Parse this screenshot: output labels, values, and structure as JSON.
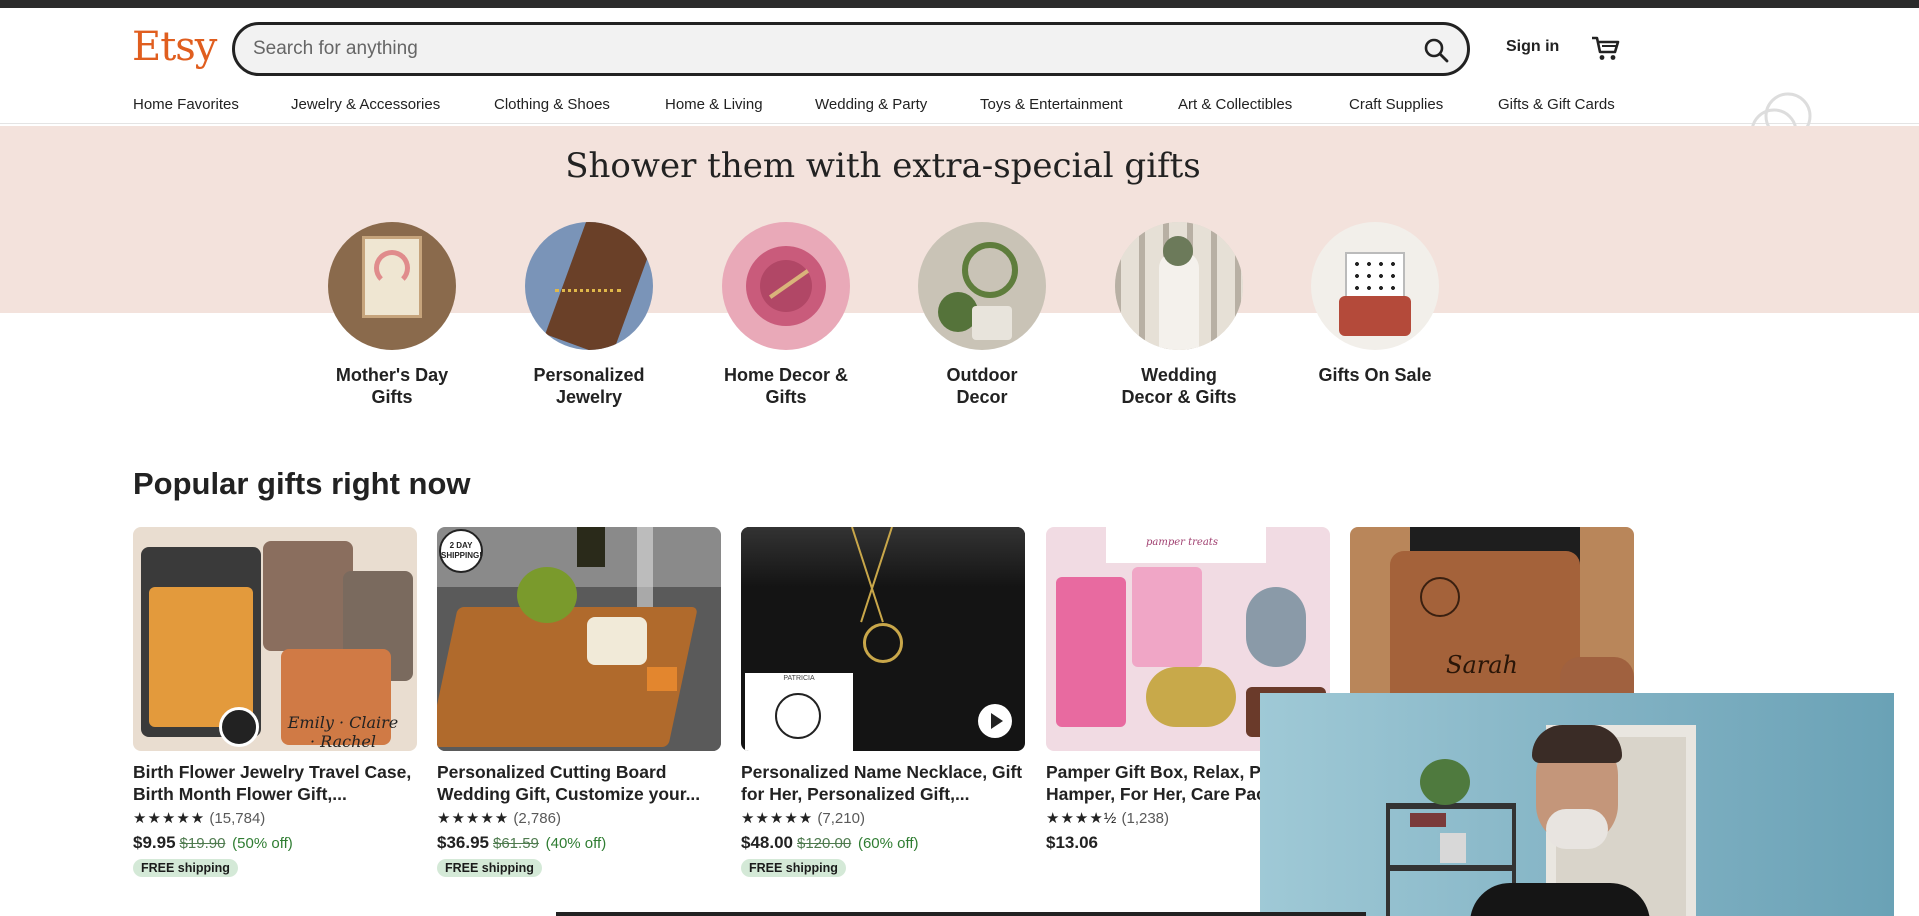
{
  "header": {
    "logo": "Etsy",
    "search_placeholder": "Search for anything",
    "signin_label": "Sign in",
    "brand_color": "#e05e1f"
  },
  "nav": {
    "items": [
      "Home Favorites",
      "Jewelry & Accessories",
      "Clothing & Shoes",
      "Home & Living",
      "Wedding & Party",
      "Toys & Entertainment",
      "Art & Collectibles",
      "Craft Supplies",
      "Gifts & Gift Cards"
    ]
  },
  "hero": {
    "title": "Shower them with extra-special gifts",
    "categories": [
      {
        "label_line1": "Mother's Day",
        "label_line2": "Gifts"
      },
      {
        "label_line1": "Personalized",
        "label_line2": "Jewelry"
      },
      {
        "label_line1": "Home Decor &",
        "label_line2": "Gifts"
      },
      {
        "label_line1": "Outdoor",
        "label_line2": "Decor"
      },
      {
        "label_line1": "Wedding",
        "label_line2": "Decor & Gifts"
      },
      {
        "label_line1": "Gifts On Sale",
        "label_line2": ""
      }
    ]
  },
  "popular": {
    "title": "Popular gifts right now",
    "cards": [
      {
        "title": "Birth Flower Jewelry Travel Case, Birth Month Flower Gift,...",
        "stars": "★★★★★",
        "reviews": "(15,784)",
        "price": "$9.95",
        "old_price": "$19.90",
        "discount": "(50% off)",
        "badge": "FREE shipping",
        "img_text": "Emily · Claire · Rachel"
      },
      {
        "title": "Personalized Cutting Board Wedding Gift, Customize your...",
        "stars": "★★★★★",
        "reviews": "(2,786)",
        "price": "$36.95",
        "old_price": "$61.59",
        "discount": "(40% off)",
        "badge": "FREE shipping",
        "img_badge": "2 DAY SHIPPING!"
      },
      {
        "title": "Personalized Name Necklace, Gift for Her, Personalized Gift,...",
        "stars": "★★★★★",
        "reviews": "(7,210)",
        "price": "$48.00",
        "old_price": "$120.00",
        "discount": "(60% off)",
        "badge": "FREE shipping",
        "img_text": "PATRICIA"
      },
      {
        "title": "Pamper Gift Box, Relax, Pamper Hamper, For Her, Care Package",
        "stars": "★★★★½",
        "reviews": "(1,238)",
        "price": "$13.06",
        "old_price": "",
        "discount": "",
        "badge": "",
        "img_text": "pamper treats"
      },
      {
        "title": "",
        "stars": "",
        "reviews": "",
        "price": "",
        "old_price": "",
        "discount": "",
        "badge": "",
        "img_text": "Sarah"
      }
    ]
  },
  "icons": {
    "search": "search-icon",
    "cart": "cart-icon",
    "share": "share-icon",
    "play": "play-icon"
  }
}
